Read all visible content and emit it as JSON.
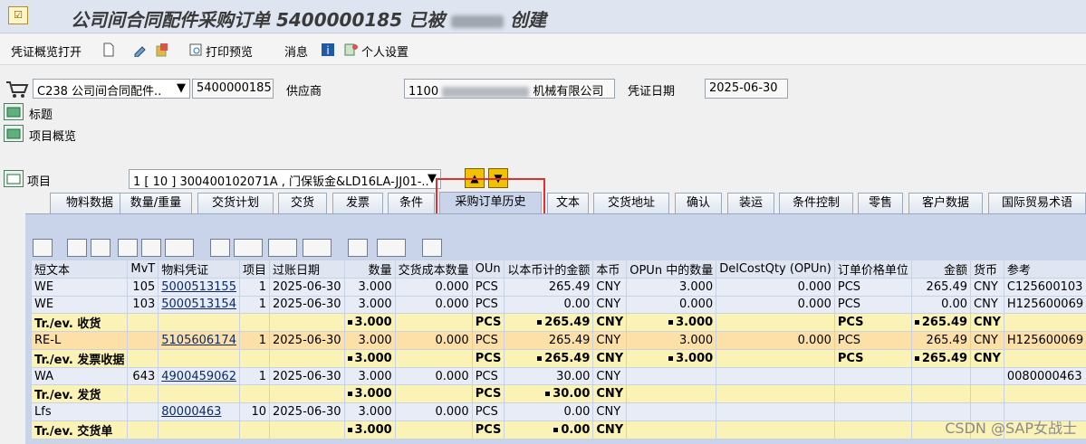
{
  "title": {
    "prefix": "公司间合同配件采购订单 5400000185 已被",
    "suffix": "创建"
  },
  "toolbar": {
    "doc_overview": "凭证概览打开",
    "print_preview": "打印预览",
    "messages": "消息",
    "personal_settings": "个人设置"
  },
  "header": {
    "doc_type": "C238 公司间合同配件..",
    "po_number": "5400000185",
    "supplier_label": "供应商",
    "supplier_code": "1100",
    "supplier_name_suffix": "机械有限公司",
    "doc_date_label": "凭证日期",
    "doc_date": "2025-06-30",
    "section_header": "标题",
    "section_items_overview": "项目概览",
    "item_label": "项目",
    "item_value": "1 [ 10 ] 300400102071A , 门保钣金&LD16LA-JJ01-.."
  },
  "tabs": [
    {
      "label": "物料数据"
    },
    {
      "label": "数量/重量"
    },
    {
      "label": "交货计划"
    },
    {
      "label": "交货"
    },
    {
      "label": "发票"
    },
    {
      "label": "条件"
    },
    {
      "label": "采购订单历史"
    },
    {
      "label": "文本"
    },
    {
      "label": "交货地址"
    },
    {
      "label": "确认"
    },
    {
      "label": "装运"
    },
    {
      "label": "条件控制"
    },
    {
      "label": "零售"
    },
    {
      "label": "客户数据"
    },
    {
      "label": "国际贸易术语"
    }
  ],
  "active_tab": "采购订单历史",
  "grid": {
    "columns": [
      "短文本",
      "MvT",
      "物料凭证",
      "项目",
      "过账日期",
      "数量",
      "交货成本数量",
      "OUn",
      "以本币计的金额",
      "本币",
      "OPUn 中的数量",
      "DelCostQty (OPUn)",
      "订单价格单位",
      "金额",
      "货币",
      "参考"
    ],
    "rows": [
      {
        "type": "data",
        "c": [
          "WE",
          "105",
          "5000513155",
          "1",
          "2025-06-30",
          "3.000",
          "0.000",
          "PCS",
          "265.49",
          "CNY",
          "3.000",
          "0.000",
          "PCS",
          "265.49",
          "CNY",
          "C125600103"
        ]
      },
      {
        "type": "data",
        "c": [
          "WE",
          "103",
          "5000513154",
          "1",
          "2025-06-30",
          "3.000",
          "0.000",
          "PCS",
          "0.00",
          "CNY",
          "0.000",
          "0.000",
          "PCS",
          "0.00",
          "CNY",
          "H125600069"
        ]
      },
      {
        "type": "sum",
        "c": [
          "Tr./ev. 收货",
          "",
          "",
          "",
          "",
          "3.000",
          "",
          "PCS",
          "265.49",
          "CNY",
          "3.000",
          "",
          "PCS",
          "265.49",
          "CNY",
          ""
        ]
      },
      {
        "type": "sel",
        "c": [
          "RE-L",
          "",
          "5105606174",
          "1",
          "2025-06-30",
          "3.000",
          "0.000",
          "PCS",
          "265.49",
          "CNY",
          "3.000",
          "0.000",
          "PCS",
          "265.49",
          "CNY",
          "H125600069"
        ]
      },
      {
        "type": "sum",
        "c": [
          "Tr./ev. 发票收据",
          "",
          "",
          "",
          "",
          "3.000",
          "",
          "PCS",
          "265.49",
          "CNY",
          "3.000",
          "",
          "PCS",
          "265.49",
          "CNY",
          ""
        ]
      },
      {
        "type": "data",
        "c": [
          "WA",
          "643",
          "4900459062",
          "1",
          "2025-06-30",
          "3.000",
          "0.000",
          "PCS",
          "30.00",
          "CNY",
          "",
          "",
          "",
          "",
          "",
          "0080000463"
        ]
      },
      {
        "type": "sum",
        "c": [
          "Tr./ev. 发货",
          "",
          "",
          "",
          "",
          "3.000",
          "",
          "PCS",
          "30.00",
          "CNY",
          "",
          "",
          "",
          "",
          "",
          ""
        ]
      },
      {
        "type": "data",
        "c": [
          "Lfs",
          "",
          "80000463",
          "10",
          "2025-06-30",
          "3.000",
          "0.000",
          "PCS",
          "0.00",
          "CNY",
          "",
          "",
          "",
          "",
          "",
          ""
        ]
      },
      {
        "type": "sum",
        "c": [
          "Tr./ev. 交货单",
          "",
          "",
          "",
          "",
          "3.000",
          "",
          "PCS",
          "0.00",
          "CNY",
          "",
          "",
          "",
          "",
          "",
          ""
        ]
      }
    ]
  },
  "watermark": "CSDN @SAP女战士",
  "colors": {
    "highlight_box": "#e12f2f",
    "tab_panel": "#c9d4ea",
    "sum_row": "#fbf2b6"
  }
}
